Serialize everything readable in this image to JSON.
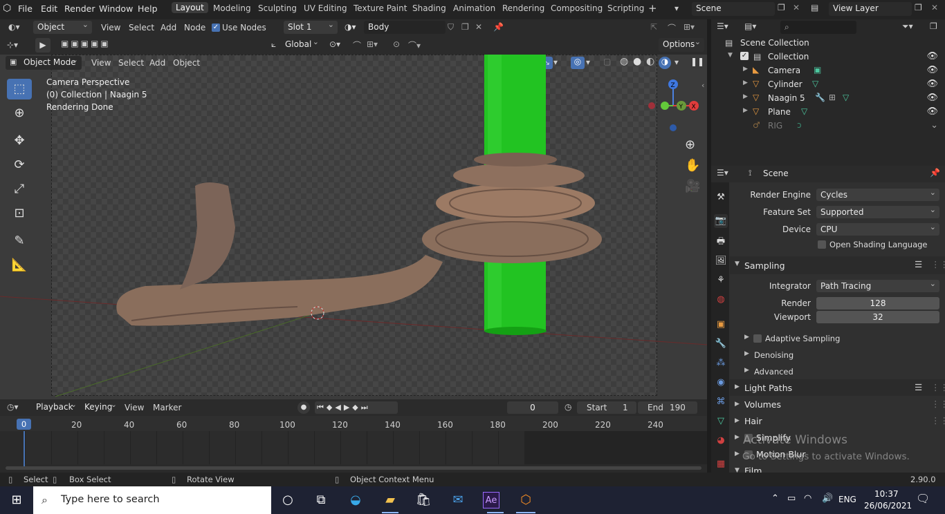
{
  "menu": {
    "file": "File",
    "edit": "Edit",
    "render": "Render",
    "window": "Window",
    "help": "Help"
  },
  "workspaces": [
    "Layout",
    "Modeling",
    "Sculpting",
    "UV Editing",
    "Texture Paint",
    "Shading",
    "Animation",
    "Rendering",
    "Compositing",
    "Scripting"
  ],
  "scene_name": "Scene",
  "view_layer": "View Layer",
  "node_header": {
    "object": "Object",
    "view": "View",
    "select": "Select",
    "add": "Add",
    "node": "Node",
    "use_nodes": "Use Nodes",
    "slot": "Slot 1",
    "material": "Body"
  },
  "tool_header": {
    "orientation": "Global",
    "options": "Options"
  },
  "viewport_header": {
    "mode": "Object Mode",
    "view": "View",
    "select": "Select",
    "add": "Add",
    "object": "Object"
  },
  "viewport_info": {
    "line1": "Camera Perspective",
    "line2": "(0) Collection | Naagin 5",
    "line3": "Rendering Done"
  },
  "outliner": {
    "root": "Scene Collection",
    "collection": "Collection",
    "items": [
      "Camera",
      "Cylinder",
      "Naagin 5",
      "Plane",
      "RIG"
    ]
  },
  "properties": {
    "context": "Scene",
    "render_engine_label": "Render Engine",
    "render_engine": "Cycles",
    "feature_set_label": "Feature Set",
    "feature_set": "Supported",
    "device_label": "Device",
    "device": "CPU",
    "osl": "Open Shading Language",
    "sampling": "Sampling",
    "integrator_label": "Integrator",
    "integrator": "Path Tracing",
    "render_label": "Render",
    "render_samples": "128",
    "viewport_label": "Viewport",
    "viewport_samples": "32",
    "adaptive": "Adaptive Sampling",
    "denoising": "Denoising",
    "advanced": "Advanced",
    "light_paths": "Light Paths",
    "volumes": "Volumes",
    "hair": "Hair",
    "simplify": "Simplify",
    "motion_blur": "Motion Blur",
    "film": "Film"
  },
  "watermark": {
    "line1": "Activate Windows",
    "line2": "Go to Settings to activate Windows."
  },
  "timeline": {
    "playback": "Playback",
    "keying": "Keying",
    "view": "View",
    "marker": "Marker",
    "current_frame": "0",
    "start_label": "Start",
    "start": "1",
    "end_label": "End",
    "end": "190",
    "ticks": [
      "0",
      "20",
      "40",
      "60",
      "80",
      "100",
      "120",
      "140",
      "160",
      "180",
      "200",
      "220",
      "240"
    ]
  },
  "status": {
    "select": "Select",
    "box_select": "Box Select",
    "rotate": "Rotate View",
    "context_menu": "Object Context Menu",
    "version": "2.90.0"
  },
  "taskbar": {
    "search_placeholder": "Type here to search",
    "lang": "ENG",
    "time": "10:37",
    "date": "26/06/2021"
  },
  "colors": {
    "accent": "#4772b3",
    "green_cylinder": "#1fc71f",
    "active_frame": "#4772b3"
  }
}
